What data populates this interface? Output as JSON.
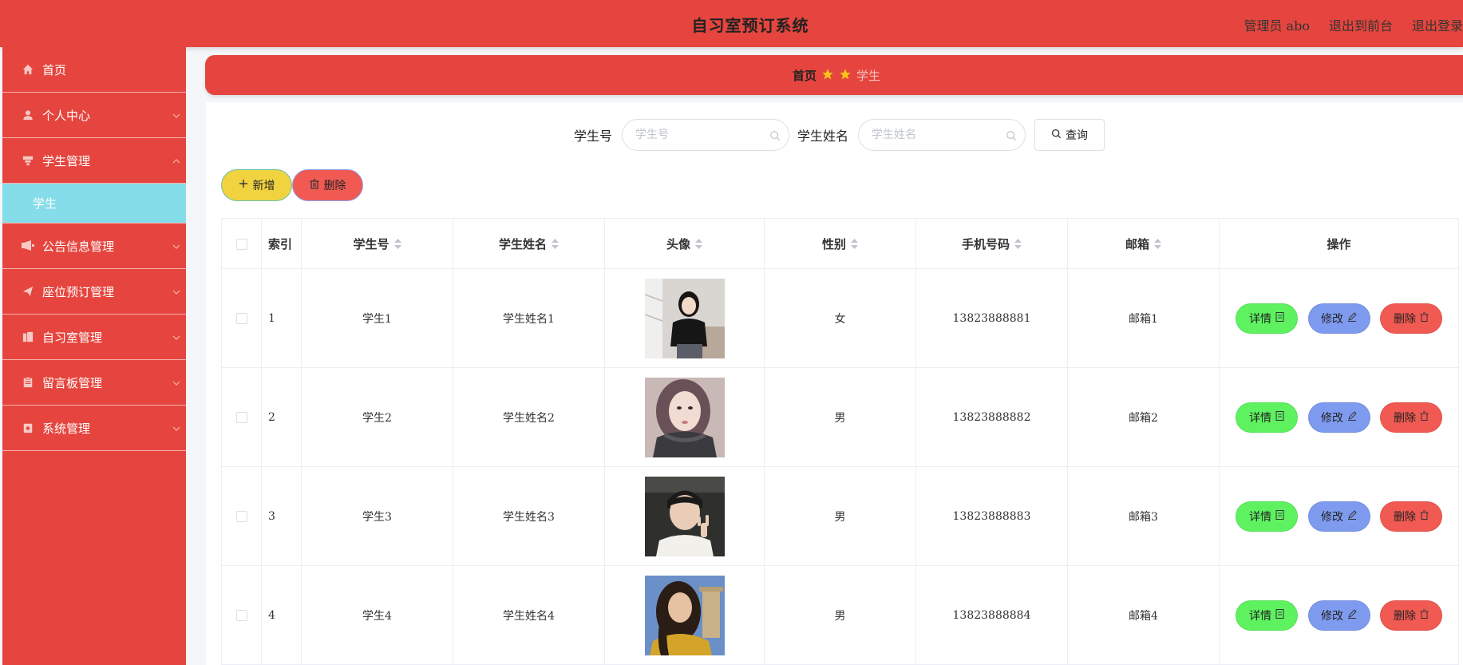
{
  "header": {
    "title": "自习室预订系统",
    "user_label": "管理员 abo",
    "front_label": "退出到前台",
    "logout_label": "退出登录"
  },
  "sidebar": {
    "items": [
      {
        "label": "首页",
        "icon": "home-icon"
      },
      {
        "label": "个人中心",
        "icon": "user-icon"
      },
      {
        "label": "学生管理",
        "icon": "student-icon",
        "expanded": true
      },
      {
        "label": "公告信息管理",
        "icon": "notice-icon"
      },
      {
        "label": "座位预订管理",
        "icon": "send-icon"
      },
      {
        "label": "自习室管理",
        "icon": "building-icon"
      },
      {
        "label": "留言板管理",
        "icon": "clipboard-icon"
      },
      {
        "label": "系统管理",
        "icon": "settings-icon"
      }
    ],
    "submenu": {
      "label": "学生"
    }
  },
  "breadcrumb": {
    "home": "首页",
    "current": "学生"
  },
  "search": {
    "field1_label": "学生号",
    "field1_placeholder": "学生号",
    "field2_label": "学生姓名",
    "field2_placeholder": "学生姓名",
    "query_label": "查询"
  },
  "actions": {
    "add_label": "新增",
    "delete_label": "删除"
  },
  "table": {
    "headers": {
      "index": "索引",
      "student_no": "学生号",
      "student_name": "学生姓名",
      "avatar": "头像",
      "gender": "性别",
      "phone": "手机号码",
      "email": "邮箱",
      "ops": "操作"
    },
    "rows": [
      {
        "index": "1",
        "student_no": "学生1",
        "student_name": "学生姓名1",
        "gender": "女",
        "phone": "13823888881",
        "email": "邮箱1"
      },
      {
        "index": "2",
        "student_no": "学生2",
        "student_name": "学生姓名2",
        "gender": "男",
        "phone": "13823888882",
        "email": "邮箱2"
      },
      {
        "index": "3",
        "student_no": "学生3",
        "student_name": "学生姓名3",
        "gender": "男",
        "phone": "13823888883",
        "email": "邮箱3"
      },
      {
        "index": "4",
        "student_no": "学生4",
        "student_name": "学生姓名4",
        "gender": "男",
        "phone": "13823888884",
        "email": "邮箱4"
      }
    ],
    "op_labels": {
      "detail": "详情",
      "edit": "修改",
      "delete": "删除"
    }
  },
  "colors": {
    "primary": "#e5453e",
    "submenu_active": "#84dde9",
    "add_button": "#f0d33f",
    "delete_button": "#f05a53",
    "detail_button": "#5ef160",
    "edit_button": "#7e9bf0",
    "star": "#f5c518"
  }
}
